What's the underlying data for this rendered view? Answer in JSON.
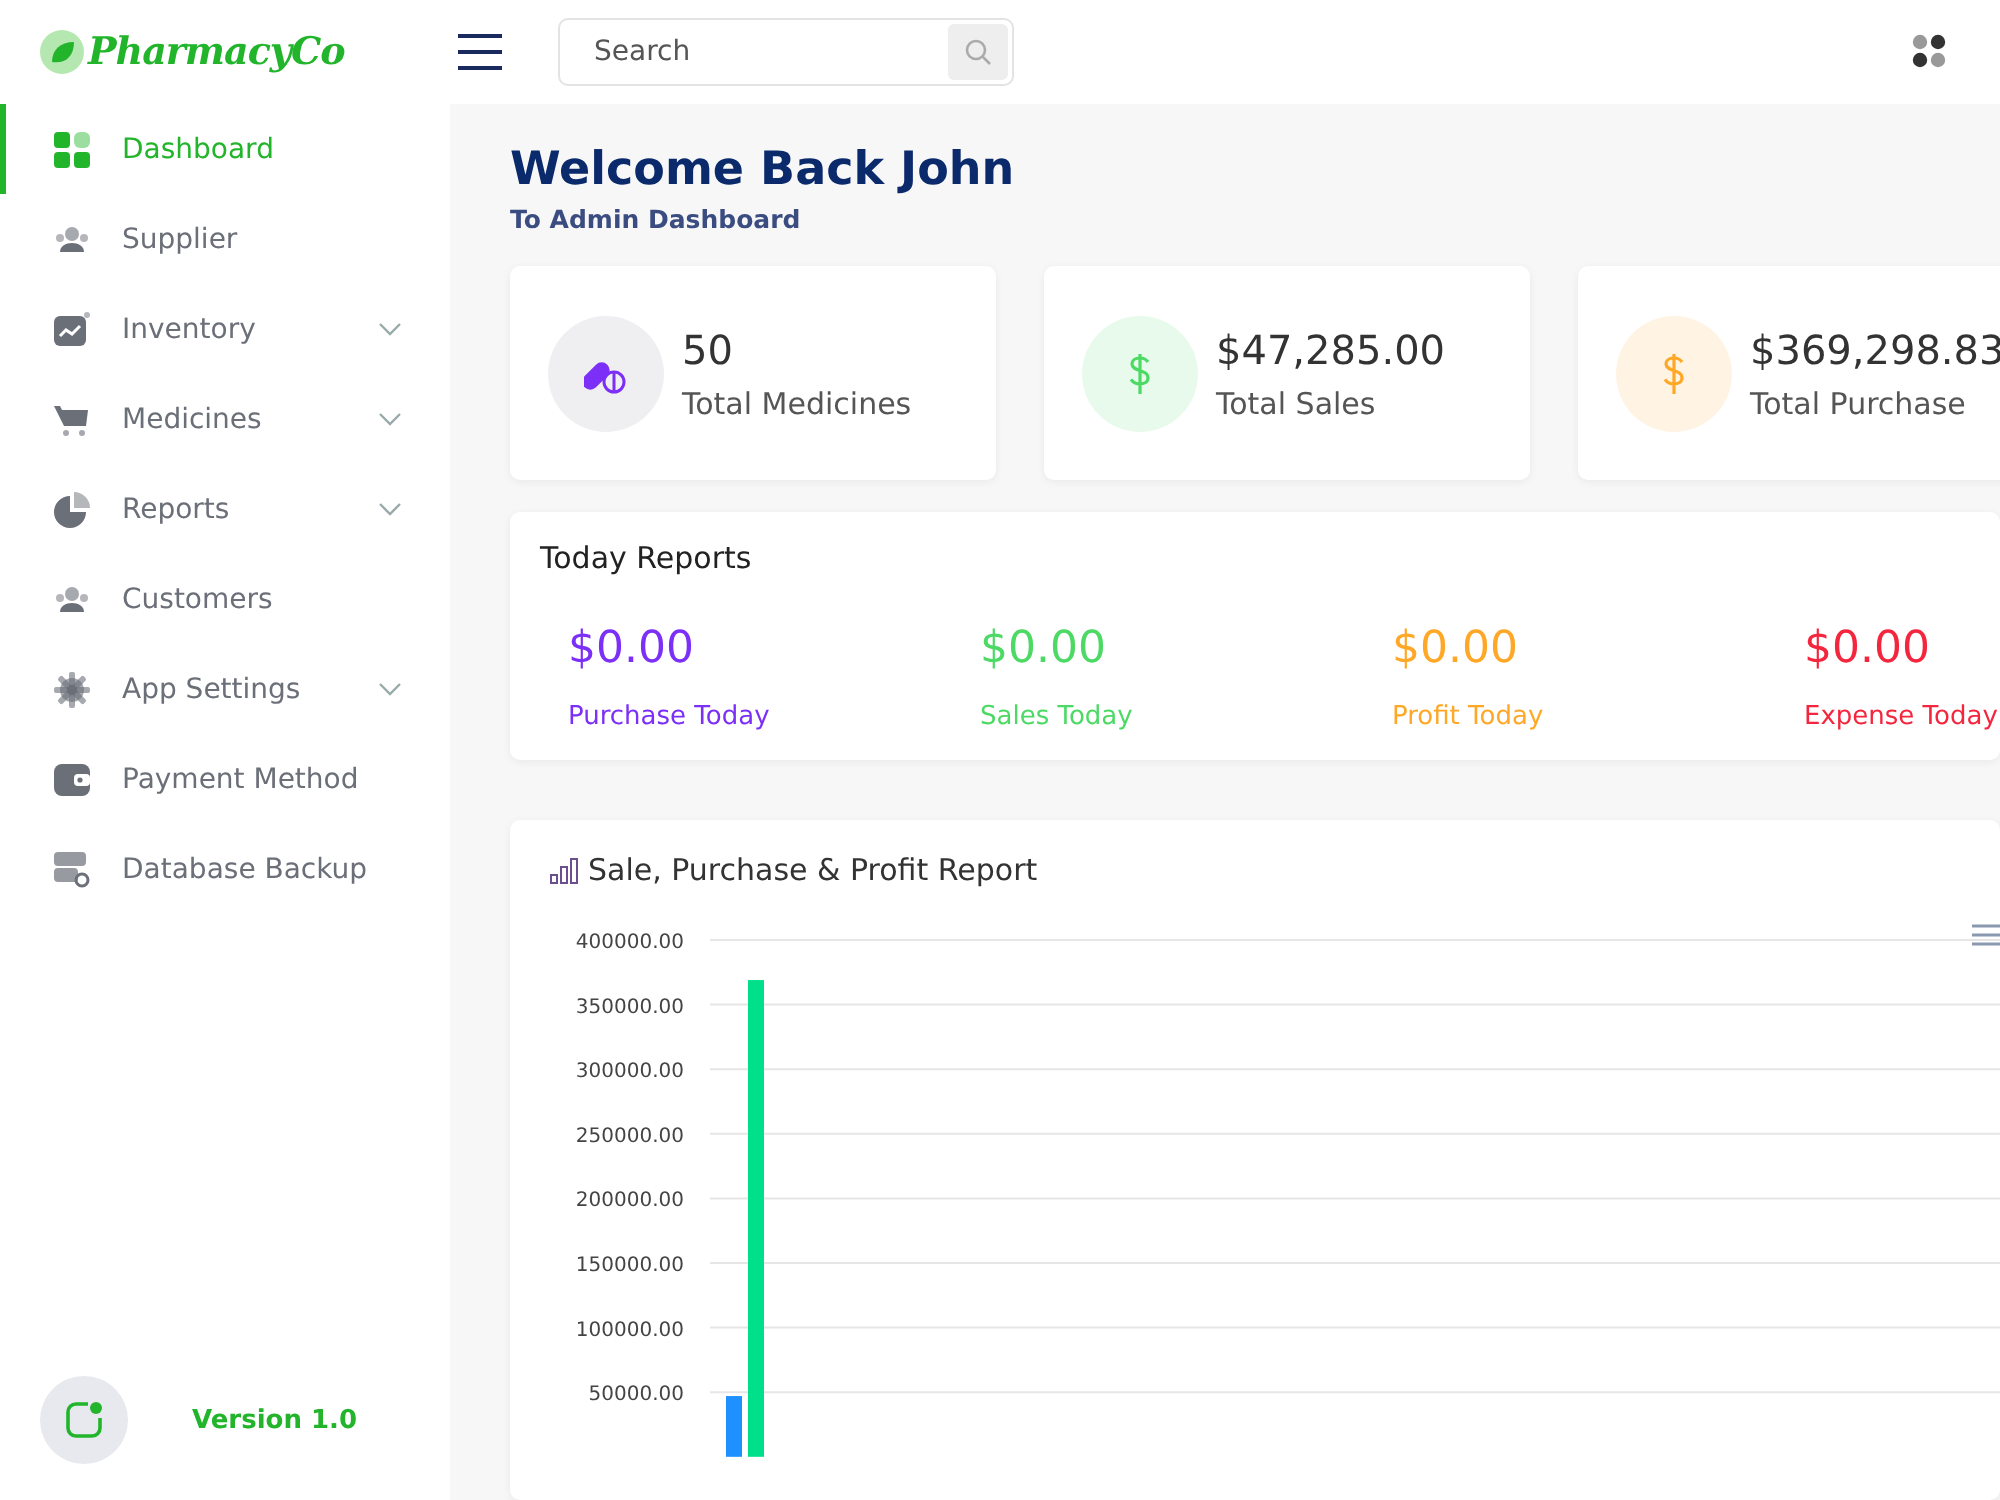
{
  "brand": {
    "name": "PharmacyCo"
  },
  "search": {
    "placeholder": "Search"
  },
  "sidebar": {
    "items": [
      {
        "label": "Dashboard",
        "selected": true,
        "expandable": false
      },
      {
        "label": "Supplier",
        "selected": false,
        "expandable": false
      },
      {
        "label": "Inventory",
        "selected": false,
        "expandable": true
      },
      {
        "label": "Medicines",
        "selected": false,
        "expandable": true
      },
      {
        "label": "Reports",
        "selected": false,
        "expandable": true
      },
      {
        "label": "Customers",
        "selected": false,
        "expandable": false
      },
      {
        "label": "App Settings",
        "selected": false,
        "expandable": true
      },
      {
        "label": "Payment Method",
        "selected": false,
        "expandable": false
      },
      {
        "label": "Database Backup",
        "selected": false,
        "expandable": false
      }
    ],
    "version": "Version 1.0"
  },
  "welcome": {
    "title": "Welcome Back John",
    "subtitle": "To Admin Dashboard"
  },
  "stats": [
    {
      "value": "50",
      "label": "Total Medicines",
      "color": "#7b2ff7"
    },
    {
      "value": "$47,285.00",
      "label": "Total Sales",
      "color": "#4cd964"
    },
    {
      "value": "$369,298.83",
      "label": "Total Purchase",
      "color": "#ffa726"
    }
  ],
  "today_reports": {
    "title": "Today Reports",
    "items": [
      {
        "value": "$0.00",
        "label": "Purchase Today",
        "color": "#7b2ff7"
      },
      {
        "value": "$0.00",
        "label": "Sales Today",
        "color": "#4cd964"
      },
      {
        "value": "$0.00",
        "label": "Profit Today",
        "color": "#ffa726"
      },
      {
        "value": "$0.00",
        "label": "Expense Today",
        "color": "#f4263e"
      }
    ]
  },
  "report_chart": {
    "title": "Sale, Purchase & Profit Report",
    "chart_data": {
      "type": "bar",
      "grid": true,
      "ylim": [
        0,
        400000
      ],
      "yticks": [
        {
          "value": 50000,
          "label": "50000.00"
        },
        {
          "value": 100000,
          "label": "100000.00"
        },
        {
          "value": 150000,
          "label": "150000.00"
        },
        {
          "value": 200000,
          "label": "200000.00"
        },
        {
          "value": 250000,
          "label": "250000.00"
        },
        {
          "value": 300000,
          "label": "300000.00"
        },
        {
          "value": 350000,
          "label": "350000.00"
        },
        {
          "value": 400000,
          "label": "400000.00"
        }
      ],
      "series": [
        {
          "color": "#1e90ff",
          "values": [
            47000
          ]
        },
        {
          "color": "#00e08a",
          "values": [
            369000
          ]
        }
      ]
    }
  }
}
